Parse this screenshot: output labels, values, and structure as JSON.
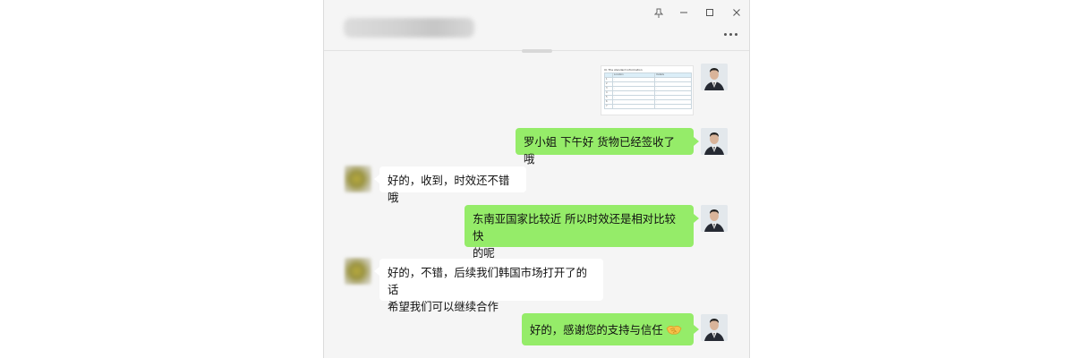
{
  "window": {
    "contact_name_redacted": true,
    "controls": [
      "pin-icon",
      "minimize-icon",
      "maximize-icon",
      "close-icon"
    ],
    "menu_icon": "more-icon"
  },
  "colors": {
    "self_bubble": "#95ec69",
    "other_bubble": "#ffffff",
    "chat_background": "#f5f5f5"
  },
  "messages": [
    {
      "sender": "self",
      "kind": "image",
      "image": "document-screenshot",
      "document": {
        "title": "III. The standard information",
        "columns": [
          "Location",
          "Details"
        ]
      }
    },
    {
      "sender": "self",
      "kind": "text",
      "text": "罗小姐 下午好 货物已经签收了哦"
    },
    {
      "sender": "other",
      "kind": "text",
      "text": "好的，收到，时效还不错哦"
    },
    {
      "sender": "self",
      "kind": "text",
      "lines": [
        "东南亚国家比较近 所以时效还是相对比较快",
        "的呢"
      ]
    },
    {
      "sender": "other",
      "kind": "text",
      "lines": [
        "好的，不错，后续我们韩国市场打开了的话",
        "希望我们可以继续合作"
      ]
    },
    {
      "sender": "self",
      "kind": "text",
      "text": "好的，感谢您的支持与信任",
      "emoji": "handshake-icon"
    }
  ]
}
